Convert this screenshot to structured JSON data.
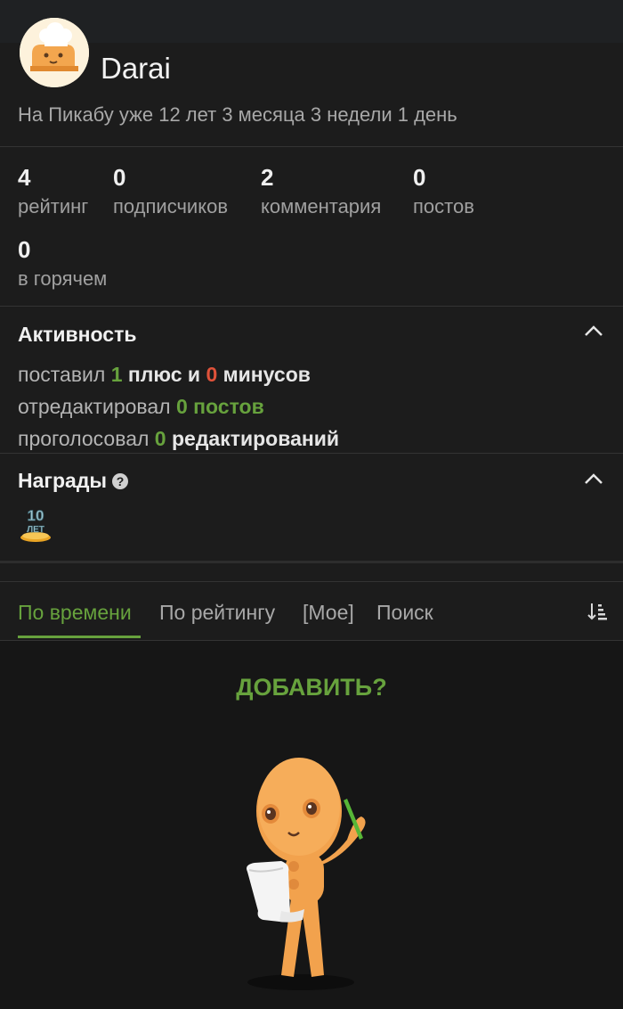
{
  "profile": {
    "username": "Darai",
    "since": "На Пикабу уже 12 лет 3 месяца 3 недели 1 день"
  },
  "stats": [
    {
      "value": "4",
      "label": "рейтинг"
    },
    {
      "value": "0",
      "label": "подписчиков"
    },
    {
      "value": "2",
      "label": "комментария"
    },
    {
      "value": "0",
      "label": "постов"
    },
    {
      "value": "0",
      "label": "в горячем"
    }
  ],
  "activity": {
    "title": "Активность",
    "line1": {
      "prefix": "поставил",
      "plus_count": "1",
      "plus_label": "плюс и",
      "minus_count": "0",
      "minus_label": "минусов"
    },
    "line2": {
      "prefix": "отредактировал",
      "count": "0",
      "label": "постов"
    },
    "line3": {
      "prefix": "проголосовал",
      "count": "0",
      "label": "редактирований"
    }
  },
  "awards": {
    "title": "Награды",
    "items": [
      {
        "badge_text": "10",
        "badge_sub": "ЛЕТ"
      }
    ]
  },
  "tabs": [
    {
      "label": "По времени",
      "active": true
    },
    {
      "label": "По рейтингу",
      "active": false
    },
    {
      "label": "[Мое]",
      "active": false
    },
    {
      "label": "Поиск",
      "active": false
    }
  ],
  "feed": {
    "add_label": "ДОБАВИТЬ?"
  },
  "colors": {
    "accent": "#67a23d",
    "minus": "#e0523a",
    "background": "#1c1c1c"
  },
  "icons": [
    "help-icon",
    "chevron-up-icon",
    "sort-icon"
  ]
}
